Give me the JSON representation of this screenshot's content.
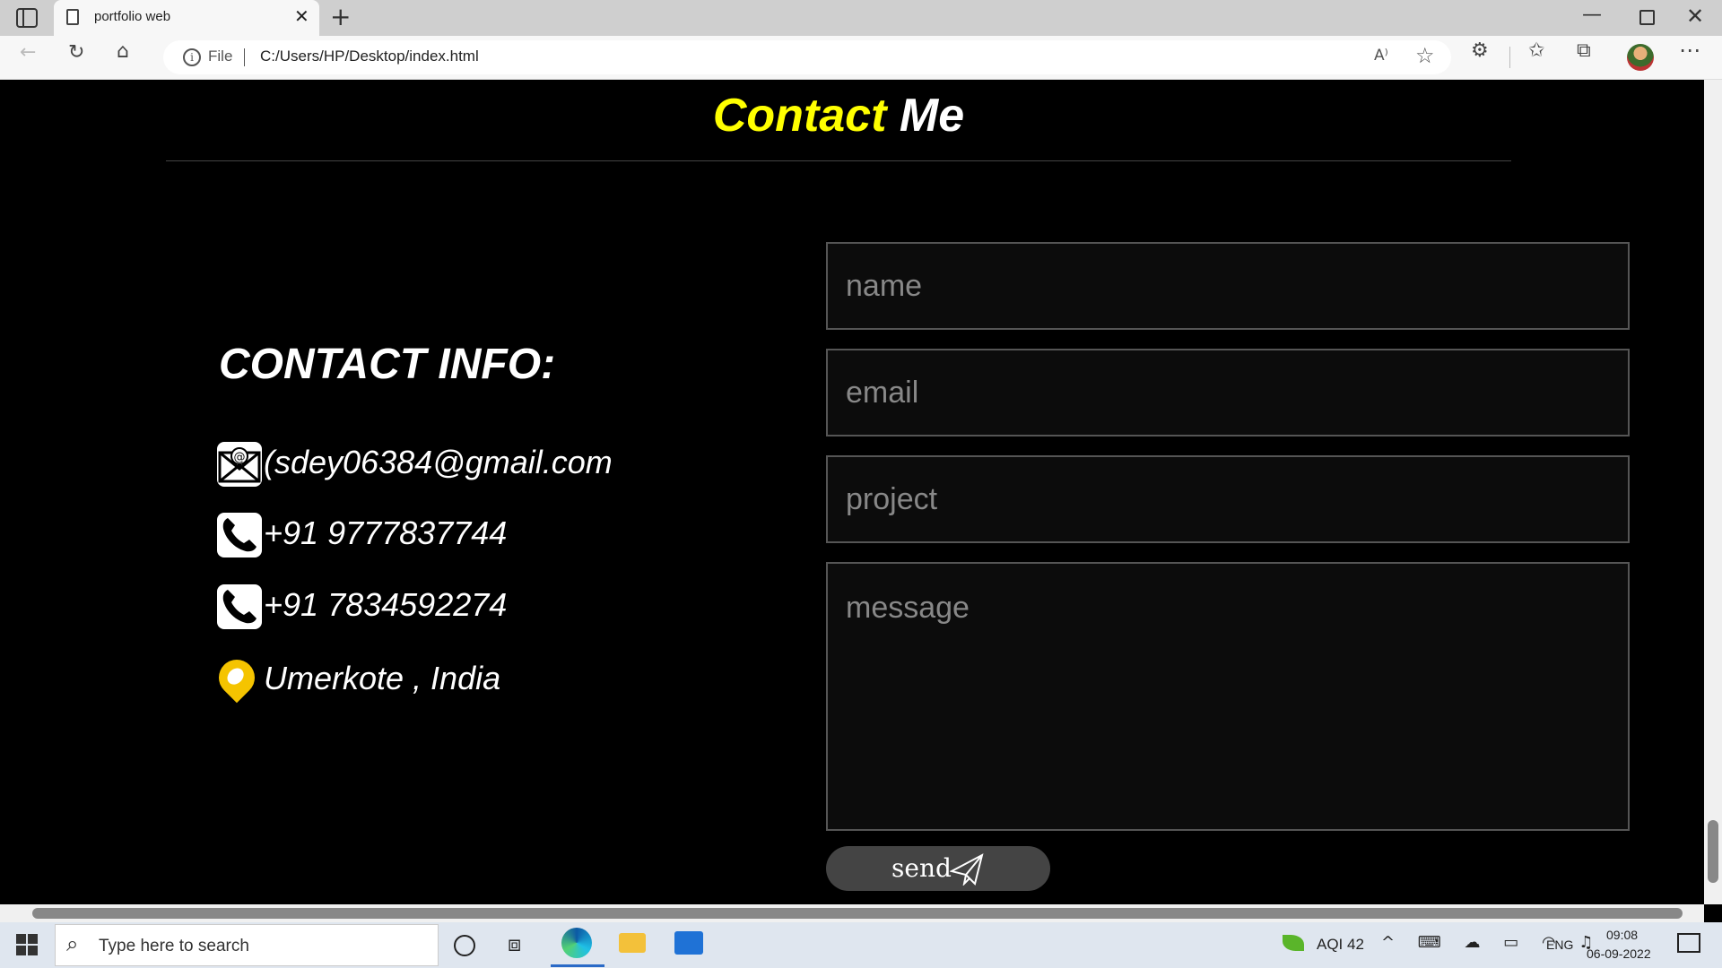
{
  "browser": {
    "tab_title": "portfolio web",
    "url_scheme_label": "File",
    "url": "C:/Users/HP/Desktop/index.html",
    "read_aloud_label": "A⁾"
  },
  "page": {
    "heading_part1": "Contact",
    "heading_part2": "Me",
    "info_title": "CONTACT INFO:",
    "email": "(sdey06384@gmail.com",
    "phone1": "+91 9777837744",
    "phone2": "+91 7834592274",
    "location": "Umerkote , India",
    "form": {
      "name_placeholder": "name",
      "email_placeholder": "email",
      "project_placeholder": "project",
      "message_placeholder": "message",
      "send_label": "send"
    }
  },
  "taskbar": {
    "search_placeholder": "Type here to search",
    "aqi": "AQI 42",
    "language": "ENG",
    "time": "09:08",
    "date": "06-09-2022"
  },
  "colors": {
    "heading_accent": "#ffff00",
    "background": "#000000",
    "location_pin": "#f5c400"
  },
  "icons": [
    "tab-actions-icon",
    "page-icon",
    "close-icon",
    "plus-icon",
    "back-icon",
    "reload-icon",
    "home-icon",
    "info-icon",
    "read-aloud-icon",
    "favorite-add-icon",
    "extensions-icon",
    "favorites-icon",
    "collections-icon",
    "more-icon",
    "mail-icon",
    "phone-icon",
    "location-pin-icon",
    "paper-plane-icon",
    "windows-icon",
    "search-icon",
    "edge-icon",
    "folder-icon",
    "mail-app-icon",
    "leaf-icon",
    "notification-icon"
  ]
}
